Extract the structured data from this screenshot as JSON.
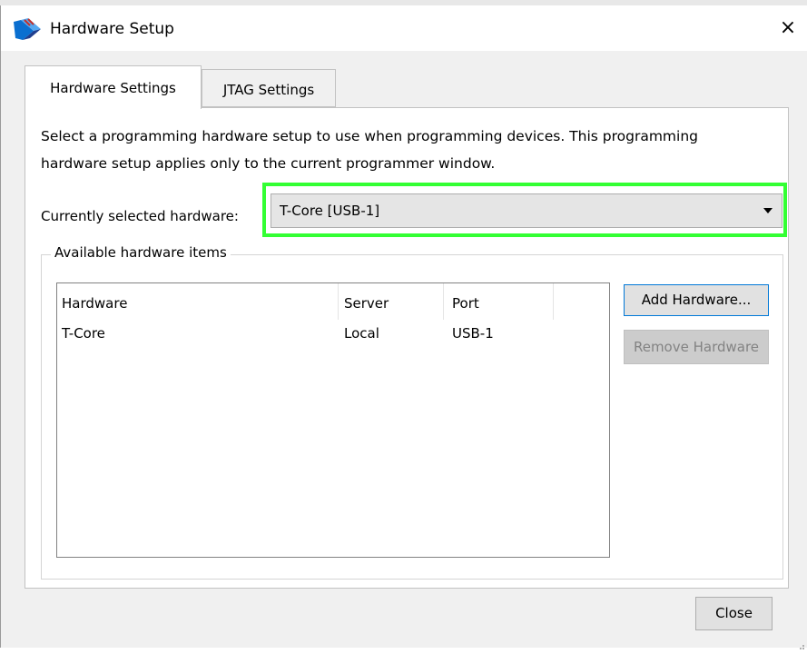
{
  "window": {
    "title": "Hardware Setup",
    "close_glyph": "×",
    "icon": "intel-quartus-icon"
  },
  "tabs": [
    {
      "label": "Hardware Settings",
      "active": true
    },
    {
      "label": "JTAG Settings",
      "active": false
    }
  ],
  "hardware_settings": {
    "description": "Select a programming hardware setup to use when programming devices. This programming hardware setup applies only to the current programmer window.",
    "selected_label": "Currently selected hardware:",
    "selected_value": "T-Core [USB-1]",
    "group_title": "Available hardware items",
    "columns": [
      "Hardware",
      "Server",
      "Port"
    ],
    "rows": [
      [
        "T-Core",
        "Local",
        "USB-1"
      ]
    ],
    "add_button": "Add Hardware...",
    "remove_button": "Remove Hardware"
  },
  "footer": {
    "close_button": "Close"
  },
  "colors": {
    "highlight": "#33ff33",
    "focus_border": "#0078d7",
    "disabled_text": "#838383"
  }
}
